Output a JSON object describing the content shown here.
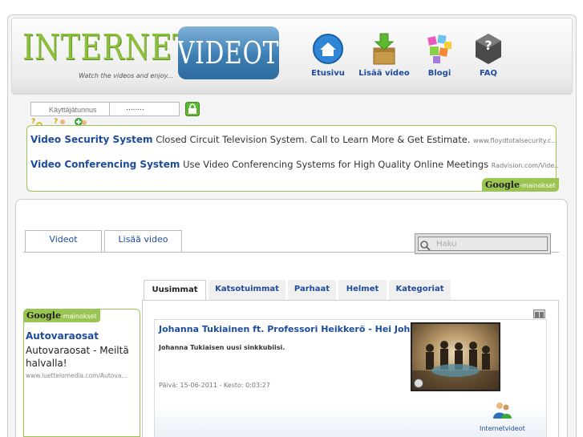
{
  "logo": {
    "text": "INTERNET",
    "badge": "VIDEOT",
    "tagline": "Watch the videos and enjoy..."
  },
  "nav": [
    {
      "label": "Etusivu",
      "icon": "home-icon"
    },
    {
      "label": "Lisää video",
      "icon": "add-video-icon"
    },
    {
      "label": "Blogi",
      "icon": "blog-icon"
    },
    {
      "label": "FAQ",
      "icon": "faq-icon"
    }
  ],
  "login": {
    "username_placeholder": "Käyttäjätunnus",
    "password_value": "........"
  },
  "top_ads": [
    {
      "title": "Video Security System",
      "body": "Closed Circuit Television System. Call to Learn More & Get Estimate.",
      "url": "www.floydtotalsecurity.c..."
    },
    {
      "title": "Video Conferencing System",
      "body": "Use Video Conferencing Systems for High Quality Online Meetings",
      "url": "Radvision.com/Vide.."
    }
  ],
  "google_badge": {
    "brand": "Google",
    "suffix": "-mainokset"
  },
  "main_tabs": [
    "Videot",
    "Lisää video"
  ],
  "search": {
    "placeholder": "Haku"
  },
  "sub_tabs": [
    "Uusimmat",
    "Katsotuimmat",
    "Parhaat",
    "Helmet",
    "Kategoriat"
  ],
  "side_ad": {
    "title": "Autovaraosat",
    "body": "Autovaraosat - Meiltä halvalla!",
    "url": "www.luettelomedia.com/Autova..."
  },
  "video": {
    "title": "Johanna Tukiainen ft. Professori Heikkerö - Hei Johanna",
    "description": "Johanna Tukiaisen uusi sinkkubiisi.",
    "meta": "Päivä: 15-06-2011 - Kesto: 0:03:27",
    "uploader": "Internetvideot"
  },
  "colors": {
    "link": "#1e4c9c",
    "accent_green": "#9bc552",
    "logo_green": "#8bbf3c",
    "logo_blue": "#3e7fb4"
  }
}
